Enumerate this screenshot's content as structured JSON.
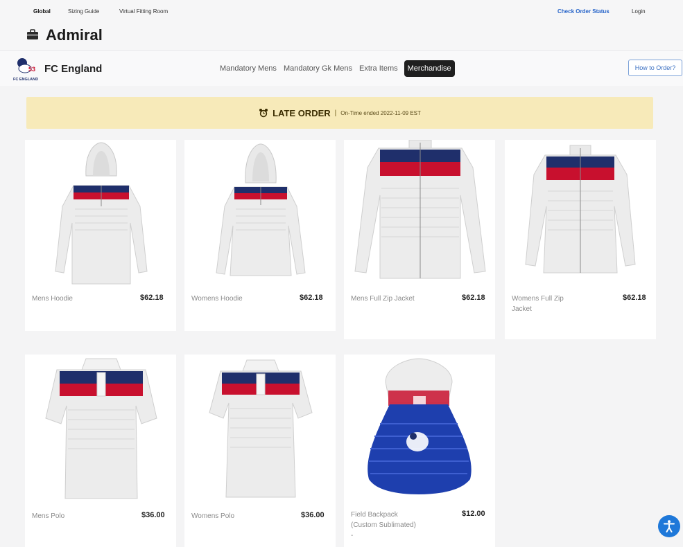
{
  "utility_nav": {
    "links": [
      "Global",
      "Sizing Guide",
      "Virtual Fitting Room"
    ],
    "order_status": "Check Order Status",
    "login": "Login"
  },
  "brand": {
    "name": "Admiral",
    "icon": "briefcase-icon"
  },
  "team": {
    "name": "FC England",
    "crest_text": "FC ENGLAND",
    "crest_icon": "lion-crest-icon"
  },
  "tabs": [
    "Mandatory Mens",
    "Mandatory Gk Mens",
    "Extra Items",
    "Merchandise"
  ],
  "active_tab": "Merchandise",
  "how_to_order": "How to Order?",
  "banner": {
    "title": "LATE ORDER",
    "separator": "|",
    "subtitle": "On-Time ended 2022-11-09 EST",
    "icon": "alarm-clock-icon",
    "background": "#f7eab9"
  },
  "products": [
    {
      "name": "Mens Hoodie",
      "price": "$62.18"
    },
    {
      "name": "Womens Hoodie",
      "price": "$62.18"
    },
    {
      "name": "Mens Full Zip Jacket",
      "price": "$62.18"
    },
    {
      "name": "Womens Full Zip Jacket",
      "price": "$62.18"
    },
    {
      "name": "Mens Polo",
      "price": "$36.00"
    },
    {
      "name": "Womens Polo",
      "price": "$36.00"
    },
    {
      "name": "Field Backpack (Custom Sublimated) -",
      "price": "$12.00"
    }
  ],
  "accessibility_button": {
    "icon": "accessibility-icon"
  },
  "colors": {
    "navy": "#1f2f6b",
    "red": "#c8102e",
    "garment_white": "#eeeeee",
    "backpack_blue": "#1e3fae",
    "link_blue": "#2563c9",
    "accessibility_blue": "#1e78d9"
  }
}
